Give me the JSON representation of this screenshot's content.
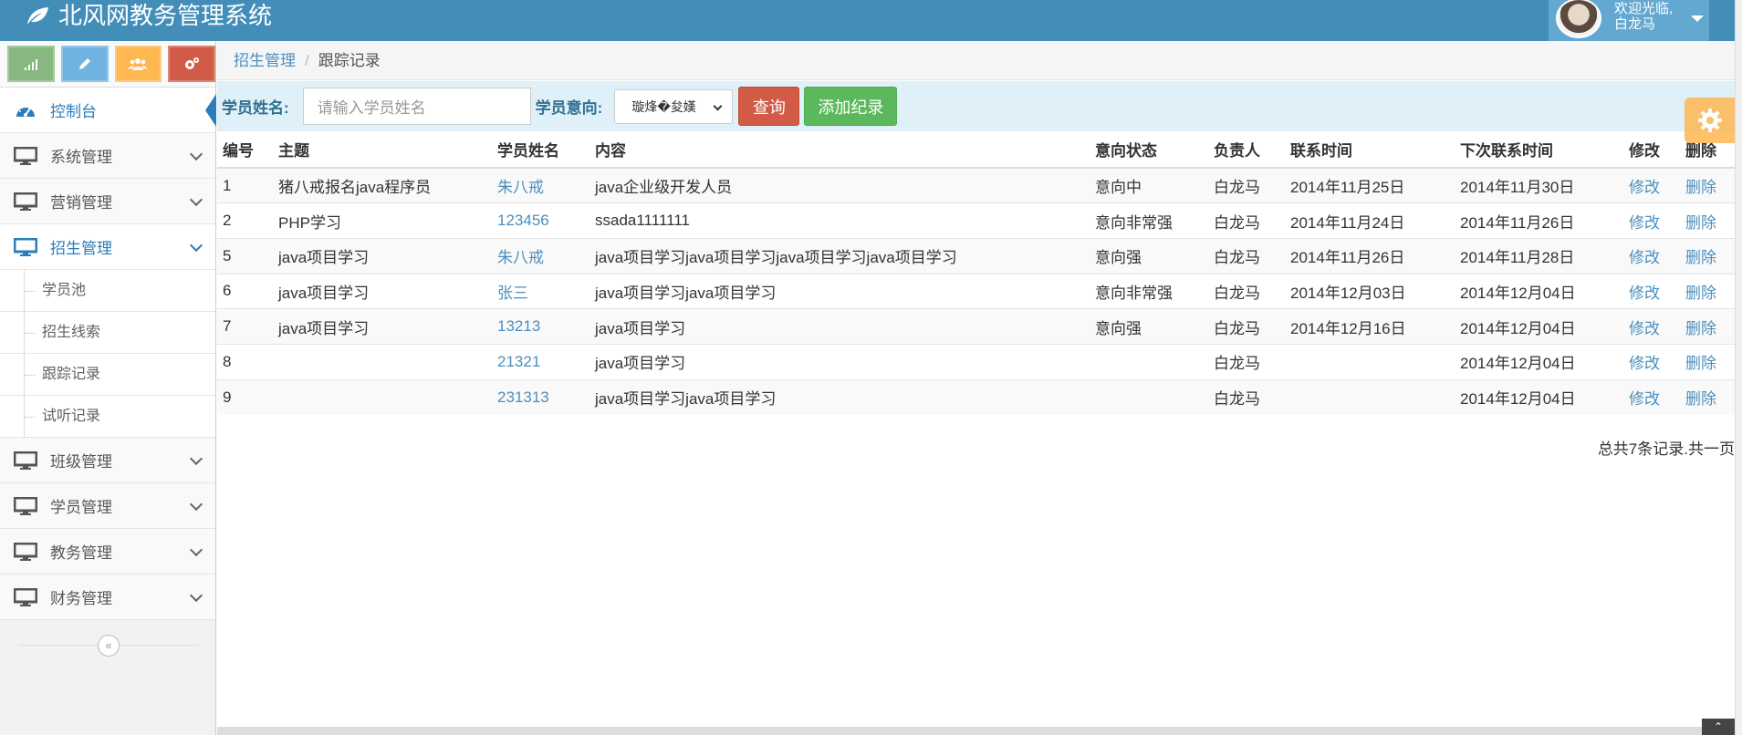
{
  "app": {
    "title": "北风网教务管理系统",
    "welcome": "欢迎光临,",
    "user_name": "白龙马"
  },
  "colors": {
    "navbar": "#438eb9",
    "link": "#4c8fbd",
    "danger": "#d15b47",
    "success": "#5cb85c",
    "warning": "#ffb752"
  },
  "shortcuts": [
    {
      "icon": "signal-icon",
      "color": "#68bc31"
    },
    {
      "icon": "pencil-icon",
      "color": "#2091cf"
    },
    {
      "icon": "group-icon",
      "color": "#fcb248"
    },
    {
      "icon": "cogs-icon",
      "color": "#da5430"
    }
  ],
  "sidebar": {
    "dashboard": "控制台",
    "system": "系统管理",
    "marketing": "营销管理",
    "enrollment": "招生管理",
    "sub_items": [
      "学员池",
      "招生线索",
      "跟踪记录",
      "试听记录"
    ],
    "class": "班级管理",
    "student": "学员管理",
    "academic": "教务管理",
    "finance": "财务管理"
  },
  "breadcrumb": {
    "parent": "招生管理",
    "current": "跟踪记录"
  },
  "search": {
    "name_label": "学员姓名:",
    "name_placeholder": "请输入学员姓名",
    "intent_label": "学员意向:",
    "intent_selected": "璇烽�夋嫨",
    "query_button": "查询",
    "add_button": "添加纪录"
  },
  "table": {
    "headers": [
      "编号",
      "主题",
      "学员姓名",
      "内容",
      "意向状态",
      "负责人",
      "联系时间",
      "下次联系时间",
      "修改",
      "删除"
    ],
    "rows": [
      {
        "id": "1",
        "topic": "猪八戒报名java程序员",
        "student": "朱八戒",
        "content": "java企业级开发人员",
        "status": "意向中",
        "owner": "白龙马",
        "contact": "2014年11月25日",
        "next": "2014年11月30日",
        "edit": "修改",
        "del": "删除"
      },
      {
        "id": "2",
        "topic": "PHP学习",
        "student": "123456",
        "content": "ssada1111111",
        "status": "意向非常强",
        "owner": "白龙马",
        "contact": "2014年11月24日",
        "next": "2014年11月26日",
        "edit": "修改",
        "del": "删除"
      },
      {
        "id": "5",
        "topic": "java项目学习",
        "student": "朱八戒",
        "content": "java项目学习java项目学习java项目学习java项目学习",
        "status": "意向强",
        "owner": "白龙马",
        "contact": "2014年11月26日",
        "next": "2014年11月28日",
        "edit": "修改",
        "del": "删除"
      },
      {
        "id": "6",
        "topic": "java项目学习",
        "student": "张三",
        "content": "java项目学习java项目学习",
        "status": "意向非常强",
        "owner": "白龙马",
        "contact": "2014年12月03日",
        "next": "2014年12月04日",
        "edit": "修改",
        "del": "删除"
      },
      {
        "id": "7",
        "topic": "java项目学习",
        "student": "13213",
        "content": "java项目学习",
        "status": "意向强",
        "owner": "白龙马",
        "contact": "2014年12月16日",
        "next": "2014年12月04日",
        "edit": "修改",
        "del": "删除"
      },
      {
        "id": "8",
        "topic": "",
        "student": "21321",
        "content": "java项目学习",
        "status": "",
        "owner": "白龙马",
        "contact": "",
        "next": "2014年12月04日",
        "edit": "修改",
        "del": "删除"
      },
      {
        "id": "9",
        "topic": "",
        "student": "231313",
        "content": "java项目学习java项目学习",
        "status": "",
        "owner": "白龙马",
        "contact": "",
        "next": "2014年12月04日",
        "edit": "修改",
        "del": "删除"
      }
    ]
  },
  "pagination": {
    "summary": "总共7条记录.共一页"
  }
}
